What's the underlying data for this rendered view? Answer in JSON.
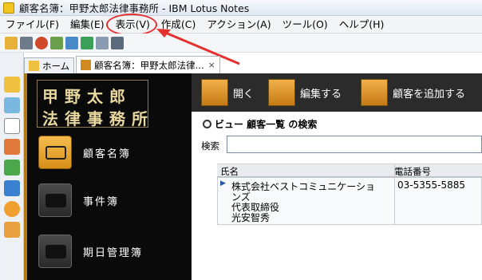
{
  "window": {
    "title": "顧客名簿：甲野太郎法律事務所 - IBM Lotus Notes"
  },
  "menu": [
    {
      "label": "ファイル(F)"
    },
    {
      "label": "編集(E)"
    },
    {
      "label": "表示(V)",
      "highlighted": true
    },
    {
      "label": "作成(C)"
    },
    {
      "label": "アクション(A)"
    },
    {
      "label": "ツール(O)"
    },
    {
      "label": "ヘルプ(H)"
    }
  ],
  "tabs": [
    {
      "label": "ホーム",
      "icon": "home-icon"
    },
    {
      "label": "顧客名簿：甲野太郎法律...",
      "icon": "database-icon",
      "close": "×"
    }
  ],
  "nav": {
    "logo_line1": "甲野太郎",
    "logo_line2": "法律事務所",
    "items": [
      {
        "label": "顧客名簿",
        "icon": "book-icon",
        "active": true
      },
      {
        "label": "事件簿",
        "icon": "book-icon",
        "active": false
      },
      {
        "label": "期日管理簿",
        "icon": "book-icon",
        "active": false
      }
    ]
  },
  "actions": [
    {
      "label": "開く",
      "icon": "open-book-icon"
    },
    {
      "label": "編集する",
      "icon": "edit-icon"
    },
    {
      "label": "顧客を追加する",
      "icon": "add-customer-icon"
    }
  ],
  "view": {
    "title": "ビュー 顧客一覧 の検索",
    "search_label": "検索",
    "search_value": "",
    "columns": [
      "氏名",
      "電話番号"
    ],
    "rows": [
      {
        "name_line1": "株式会社ベストコミュニケーショ",
        "name_line2": "ンズ",
        "name_line3": "代表取締役",
        "name_line4": "光安智秀",
        "phone": "03-5355-5885"
      }
    ]
  },
  "colors": {
    "accent": "#e53030",
    "gold": "#d98f1a",
    "dark_panel": "#0a0a0a"
  }
}
